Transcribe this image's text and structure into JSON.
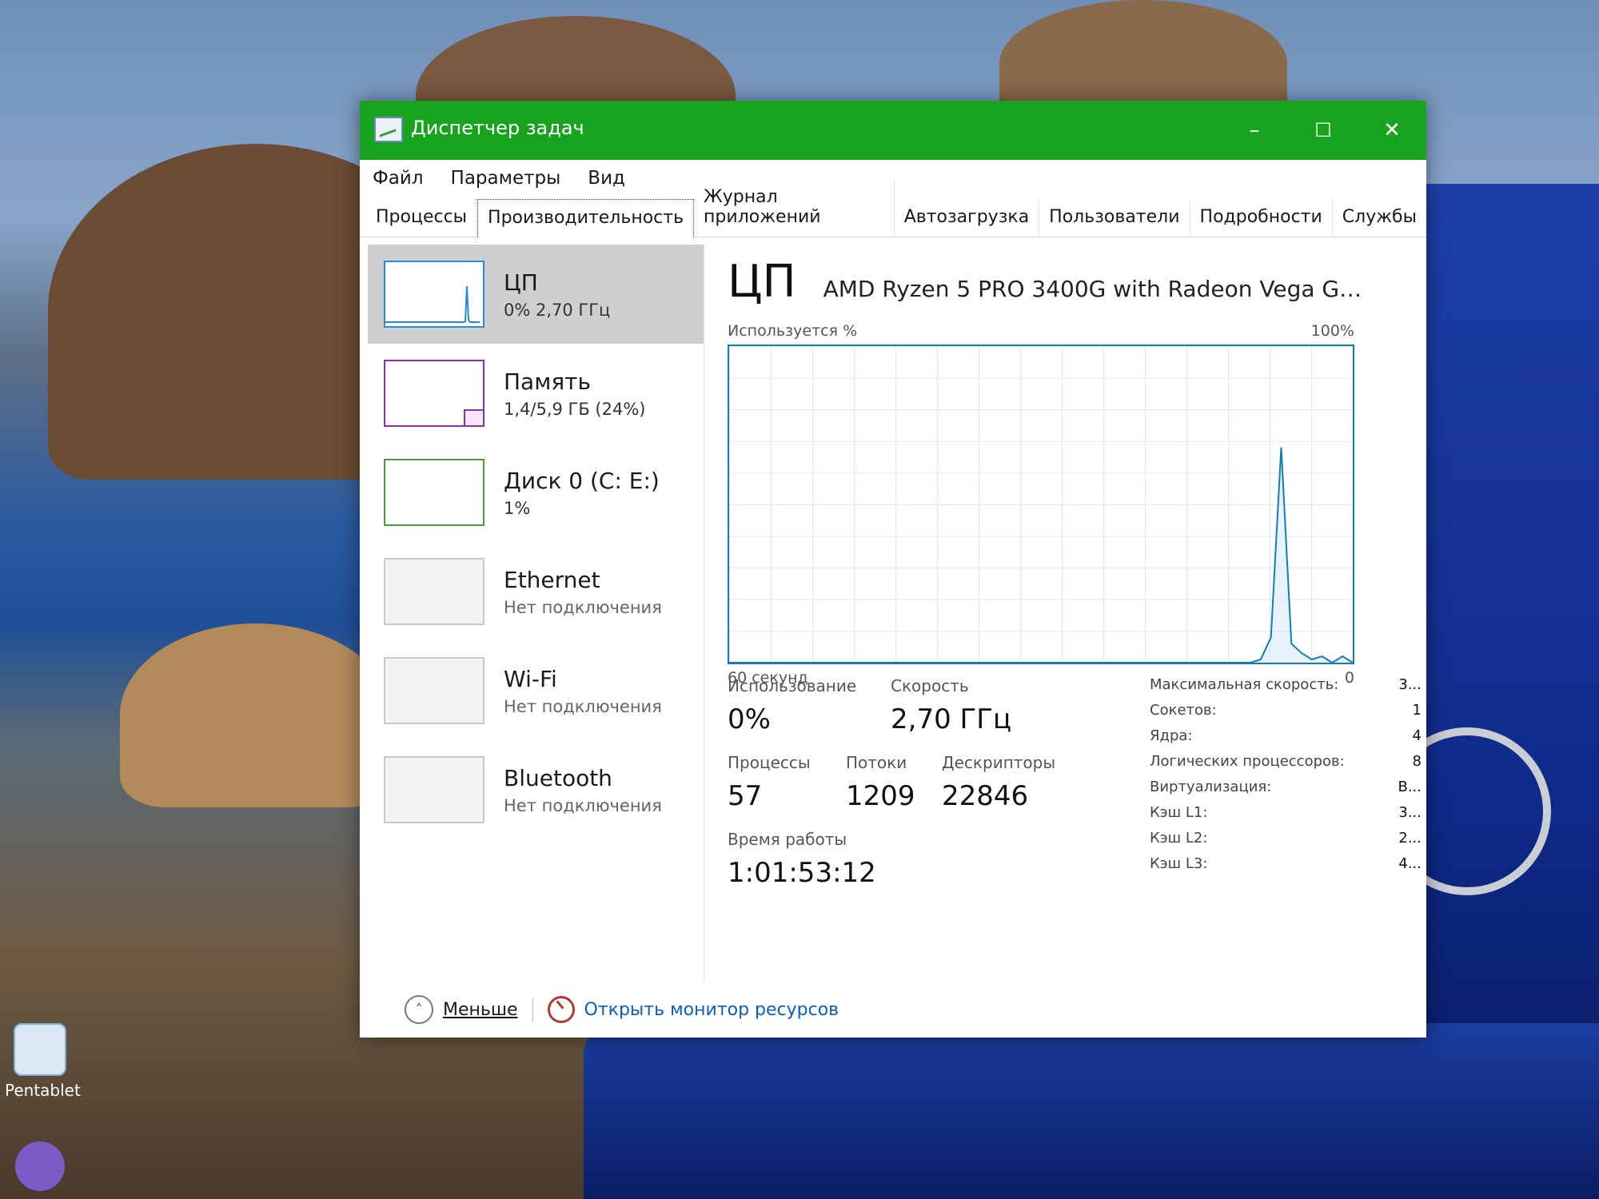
{
  "desktop": {
    "icons": [
      {
        "label": "Pentablet",
        "icon": "pentablet-icon"
      },
      {
        "label": "",
        "icon": "viber-icon"
      }
    ],
    "colors": {
      "car": "#1b3da0",
      "sky": "#7f9cc4",
      "water": "#2457a3"
    }
  },
  "window": {
    "title": "Диспетчер задач",
    "accent": "#18a31e",
    "controls": {
      "minimize": "–",
      "maximize": "☐",
      "close": "✕"
    },
    "menu": [
      "Файл",
      "Параметры",
      "Вид"
    ],
    "tabs": [
      "Процессы",
      "Производительность",
      "Журнал приложений",
      "Автозагрузка",
      "Пользователи",
      "Подробности",
      "Службы"
    ],
    "active_tab": "Производительность"
  },
  "sidebar": {
    "items": [
      {
        "name": "ЦП",
        "sub": "0% 2,70 ГГц",
        "color": "#2a8ad4"
      },
      {
        "name": "Память",
        "sub": "1,4/5,9 ГБ (24%)",
        "color": "#8b2fb0"
      },
      {
        "name": "Диск 0 (C: E:)",
        "sub": "1%",
        "color": "#4aa035"
      },
      {
        "name": "Ethernet",
        "sub": "Нет подключения"
      },
      {
        "name": "Wi-Fi",
        "sub": "Нет подключения"
      },
      {
        "name": "Bluetooth",
        "sub": "Нет подключения"
      }
    ]
  },
  "cpu": {
    "title": "ЦП",
    "model": "AMD Ryzen 5 PRO 3400G with Radeon Vega Gra...",
    "graph": {
      "y_label": "Используется %",
      "y_max": "100%",
      "x_label": "60 секунд",
      "y_min": "0",
      "line_color": "#117dbb",
      "usage_series": [
        0,
        0,
        0,
        0,
        0,
        0,
        0,
        0,
        0,
        0,
        0,
        0,
        0,
        0,
        0,
        0,
        0,
        0,
        0,
        0,
        0,
        0,
        0,
        0,
        0,
        0,
        0,
        0,
        0,
        0,
        0,
        0,
        0,
        0,
        0,
        0,
        0,
        0,
        0,
        0,
        0,
        0,
        0,
        0,
        0,
        0,
        0,
        0,
        0,
        0,
        0,
        0,
        1,
        8,
        68,
        6,
        3,
        1,
        2,
        0,
        2,
        0
      ]
    },
    "stats": {
      "usage": {
        "label": "Использование",
        "value": "0%"
      },
      "speed": {
        "label": "Скорость",
        "value": "2,70 ГГц"
      },
      "processes": {
        "label": "Процессы",
        "value": "57"
      },
      "threads": {
        "label": "Потоки",
        "value": "1209"
      },
      "handles": {
        "label": "Дескрипторы",
        "value": "22846"
      },
      "uptime": {
        "label": "Время работы",
        "value": "1:01:53:12"
      }
    },
    "specs": [
      {
        "label": "Максимальная скорость:",
        "value": "3..."
      },
      {
        "label": "Сокетов:",
        "value": "1"
      },
      {
        "label": "Ядра:",
        "value": "4"
      },
      {
        "label": "Логических процессоров:",
        "value": "8"
      },
      {
        "label": "Виртуализация:",
        "value": "В..."
      },
      {
        "label": "Кэш L1:",
        "value": "3..."
      },
      {
        "label": "Кэш L2:",
        "value": "2..."
      },
      {
        "label": "Кэш L3:",
        "value": "4..."
      }
    ]
  },
  "footer": {
    "less": "Меньше",
    "resource_monitor": "Открыть монитор ресурсов"
  }
}
